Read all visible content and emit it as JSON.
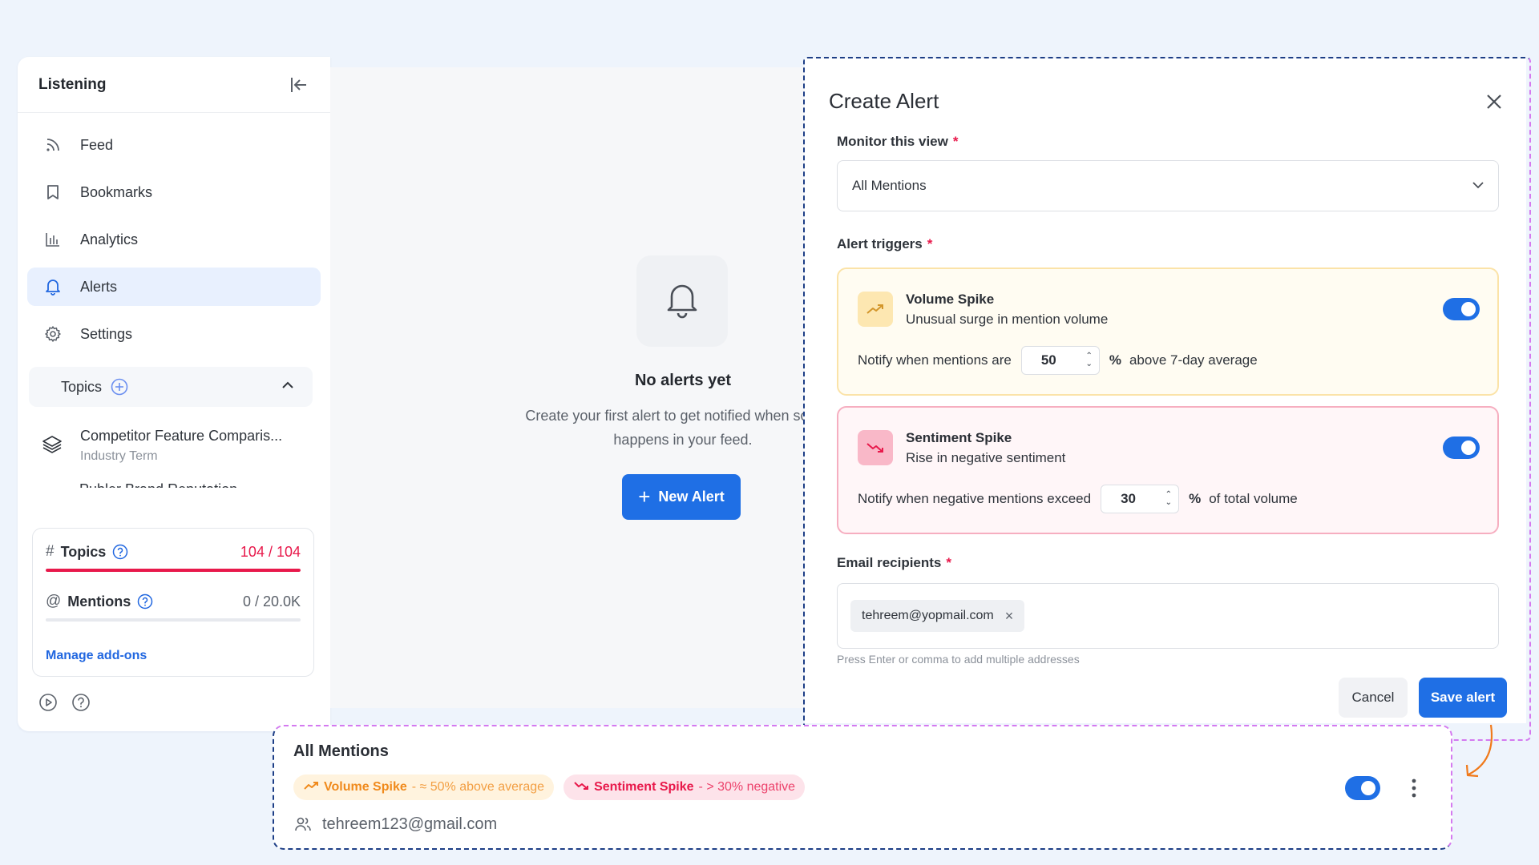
{
  "sidebar": {
    "title": "Listening",
    "collapse_icon": "collapse-left-icon",
    "nav": [
      {
        "label": "Feed",
        "icon": "rss-icon"
      },
      {
        "label": "Bookmarks",
        "icon": "bookmark-icon"
      },
      {
        "label": "Analytics",
        "icon": "bar-chart-icon"
      },
      {
        "label": "Alerts",
        "icon": "bell-icon",
        "active": true
      },
      {
        "label": "Settings",
        "icon": "gear-icon"
      }
    ],
    "topics_label": "Topics",
    "topics": [
      {
        "name": "Competitor Feature Comparis...",
        "sub": "Industry Term"
      },
      {
        "name": "Publer Brand Reputation"
      }
    ],
    "usage": {
      "topics_label": "Topics",
      "topics_value": "104 / 104",
      "topics_fill": 1.0,
      "mentions_label": "Mentions",
      "mentions_value": "0 / 20.0K",
      "mentions_fill": 0.0,
      "manage_label": "Manage add-ons"
    }
  },
  "empty_state": {
    "title": "No alerts yet",
    "text_line1": "Create your first alert to get notified when someth",
    "text_line2": "happens in your feed.",
    "button_label": "New Alert"
  },
  "modal": {
    "title": "Create Alert",
    "monitor_label": "Monitor this view",
    "monitor_value": "All Mentions",
    "triggers_label": "Alert triggers",
    "volume": {
      "name": "Volume Spike",
      "desc": "Unusual surge in mention volume",
      "prefix": "Notify when mentions are",
      "value": "50",
      "suffix": "above 7-day average",
      "enabled": true
    },
    "sentiment": {
      "name": "Sentiment Spike",
      "desc": "Rise in negative sentiment",
      "prefix": "Notify when negative mentions exceed",
      "value": "30",
      "suffix": "of total volume",
      "enabled": true
    },
    "email_label": "Email recipients",
    "email_chip": "tehreem@yopmail.com",
    "email_hint": "Press Enter or comma to add multiple addresses",
    "cancel_label": "Cancel",
    "save_label": "Save alert"
  },
  "result_card": {
    "title": "All Mentions",
    "volume_tag_name": "Volume Spike",
    "volume_tag_detail": "- ≈ 50% above average",
    "sentiment_tag_name": "Sentiment Spike",
    "sentiment_tag_detail": "- > 30% negative",
    "email": "tehreem123@gmail.com",
    "enabled": true
  },
  "colors": {
    "accent": "#1f6fe5",
    "danger": "#e8194b",
    "volume": "#f08a1c",
    "background": "#eef4fc"
  }
}
